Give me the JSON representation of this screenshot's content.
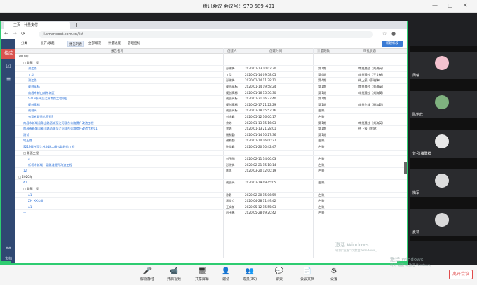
{
  "meeting": {
    "title": "腾讯会议 会议号：970 689 491"
  },
  "browser": {
    "tab_title": "主页 - 计量支付",
    "new_tab": "+",
    "url": "ji.smartcost.com.cn/list"
  },
  "side": {
    "brand": "技成",
    "more": "文档"
  },
  "toolbar": {
    "items": [
      "分类",
      "展开/收起",
      "报告列表",
      "全部概况",
      "计量进度",
      "管理招标"
    ],
    "active_index": 2,
    "new_btn": "新建标段"
  },
  "table": {
    "headers": [
      "报告名称",
      "创建人",
      "创建时间",
      "计量期数",
      "审批状态"
    ],
    "rows": [
      {
        "name": "2019年",
        "indent": 0,
        "type": "group"
      },
      {
        "name": "□ 路基工程",
        "indent": 1,
        "type": "group"
      },
      {
        "name": "浚江路",
        "indent": 2,
        "creator": "彭晓锋",
        "time": "2020-01-13 10:02:30",
        "period": "第1期",
        "status": "审批通过（刘海英）",
        "link": true
      },
      {
        "name": "丁华",
        "indent": 2,
        "creator": "丁华",
        "time": "2020-01-14 09:58:05",
        "period": "第4期",
        "status": "审批通过（王文新）",
        "link": true
      },
      {
        "name": "浚江路",
        "indent": 2,
        "creator": "彭晓锋",
        "time": "2020-01-14 11:28:11",
        "period": "第4期",
        "status": "待上报（彭晓锋）",
        "link": true
      },
      {
        "name": "视创高标",
        "indent": 2,
        "creator": "视创高标",
        "time": "2020-01-14 19:58:24",
        "period": "第1期",
        "status": "审批通过（刘海英）",
        "link": true
      },
      {
        "name": "南昌市新山城东城区",
        "indent": 2,
        "creator": "视创高标",
        "time": "2020-01-16 15:56:30",
        "period": "第1期",
        "status": "审批通过（刘海英）",
        "link": true
      },
      {
        "name": "S219泰州至江苏南路工程项目",
        "indent": 2,
        "creator": "视创高标",
        "time": "2020-01-21 16:23:40",
        "period": "第1期",
        "status": "",
        "link": true
      },
      {
        "name": "视创高标",
        "indent": 2,
        "creator": "视创高标",
        "time": "2020-02-17 21:22:29",
        "period": "第1期",
        "status": "审批完成（谢和勤）",
        "link": true
      },
      {
        "name": "视创高",
        "indent": 2,
        "creator": "视创高标",
        "time": "2020-02-18 15:53:16",
        "period": "台账",
        "status": "",
        "link": true
      },
      {
        "name": "有没有联系人签到?",
        "indent": 2,
        "creator": "刘金鑫",
        "time": "2020-05-12 16:00:17",
        "period": "台账",
        "status": "",
        "link": true
      },
      {
        "name": "南昌市新城县象山路西城至江河县东公路提升改造工程",
        "indent": 1,
        "creator": "余婷",
        "time": "2020-01-13 15:16:03",
        "period": "第1期",
        "status": "审批通过（刘海英）",
        "link": true
      },
      {
        "name": "南昌市新城县象山路西城至江河县东公路提升改造工程01",
        "indent": 1,
        "creator": "余婷",
        "time": "2020-01-13 21:28:01",
        "period": "第1期",
        "status": "待上报（余婷）",
        "link": true
      },
      {
        "name": "测试",
        "indent": 1,
        "creator": "谢和勤",
        "time": "2020-01-14 10:27:36",
        "period": "第1期",
        "status": "",
        "link": true
      },
      {
        "name": "地王路",
        "indent": 1,
        "creator": "谢和勤",
        "time": "2020-01-14 16:00:27",
        "period": "台账",
        "status": "",
        "link": true
      },
      {
        "name": "S219泰州至江苏南路二级公路改造工程",
        "indent": 1,
        "creator": "孙佳鑫",
        "time": "2020-01-20 10:42:47",
        "period": "台账",
        "status": "",
        "link": true
      },
      {
        "name": "□ 路面工程",
        "indent": 1,
        "type": "group"
      },
      {
        "name": "a",
        "indent": 2,
        "creator": "刘玉明",
        "time": "2020-02-11 14:06:03",
        "period": "台账",
        "status": "",
        "link": true
      },
      {
        "name": "新桥市新城一级路道提升改造工程",
        "indent": 2,
        "creator": "彭晓锋",
        "time": "2020-02-21 15:18:14",
        "period": "台账",
        "status": "",
        "link": true
      },
      {
        "name": "12",
        "indent": 1,
        "creator": "陈凯",
        "time": "2020-03-20 12:00:19",
        "period": "台账",
        "status": "",
        "link": true
      },
      {
        "name": "□ 2020年",
        "indent": 0,
        "type": "group"
      },
      {
        "name": "A1",
        "indent": 1,
        "creator": "视创高",
        "time": "2020-02-19 09:45:05",
        "period": "台账",
        "status": "",
        "link": true
      },
      {
        "name": "□ 路基工程",
        "indent": 1,
        "type": "group"
      },
      {
        "name": "A1",
        "indent": 2,
        "creator": "徐静",
        "time": "2020-02-20 15:06:59",
        "period": "台账",
        "status": "",
        "link": true
      },
      {
        "name": "ZH_XX公路",
        "indent": 2,
        "creator": "易佳立",
        "time": "2020-04-28 11:49:42",
        "period": "台账",
        "status": "",
        "link": true
      },
      {
        "name": "A1",
        "indent": 2,
        "creator": "王文新",
        "time": "2020-05-12 15:55:03",
        "period": "台账",
        "status": "",
        "link": true
      },
      {
        "name": "—",
        "indent": 1,
        "creator": "彭子彬",
        "time": "2020-05-28 09:20:42",
        "period": "台账",
        "status": "",
        "link": true
      }
    ]
  },
  "participants": [
    {
      "name": "周瑞",
      "color": "#f4c2cf"
    },
    {
      "name": "陈怡欣",
      "color": "#7fb27f"
    },
    {
      "name": "曾·张维鹭祥",
      "color": "#e8e8e8"
    },
    {
      "name": "梅军",
      "color": "#dcdcdc"
    },
    {
      "name": "夏杭",
      "color": "#d9d9d9"
    }
  ],
  "bottom": {
    "items": [
      {
        "icon": "🎤",
        "label": "解除静音"
      },
      {
        "icon": "📹",
        "label": "开启视频"
      },
      {
        "icon": "🖥",
        "label": "共享屏幕"
      },
      {
        "icon": "👤",
        "label": "邀请"
      },
      {
        "icon": "👥",
        "label": "成员(39)"
      },
      {
        "icon": "💬",
        "label": "聊天"
      },
      {
        "icon": "📄",
        "label": "会议文档"
      },
      {
        "icon": "⚙",
        "label": "设置"
      }
    ],
    "leave": "离开会议"
  },
  "watermark": {
    "line1": "激活 Windows",
    "line2": "转到\"设置\"以激活 Windows。"
  }
}
